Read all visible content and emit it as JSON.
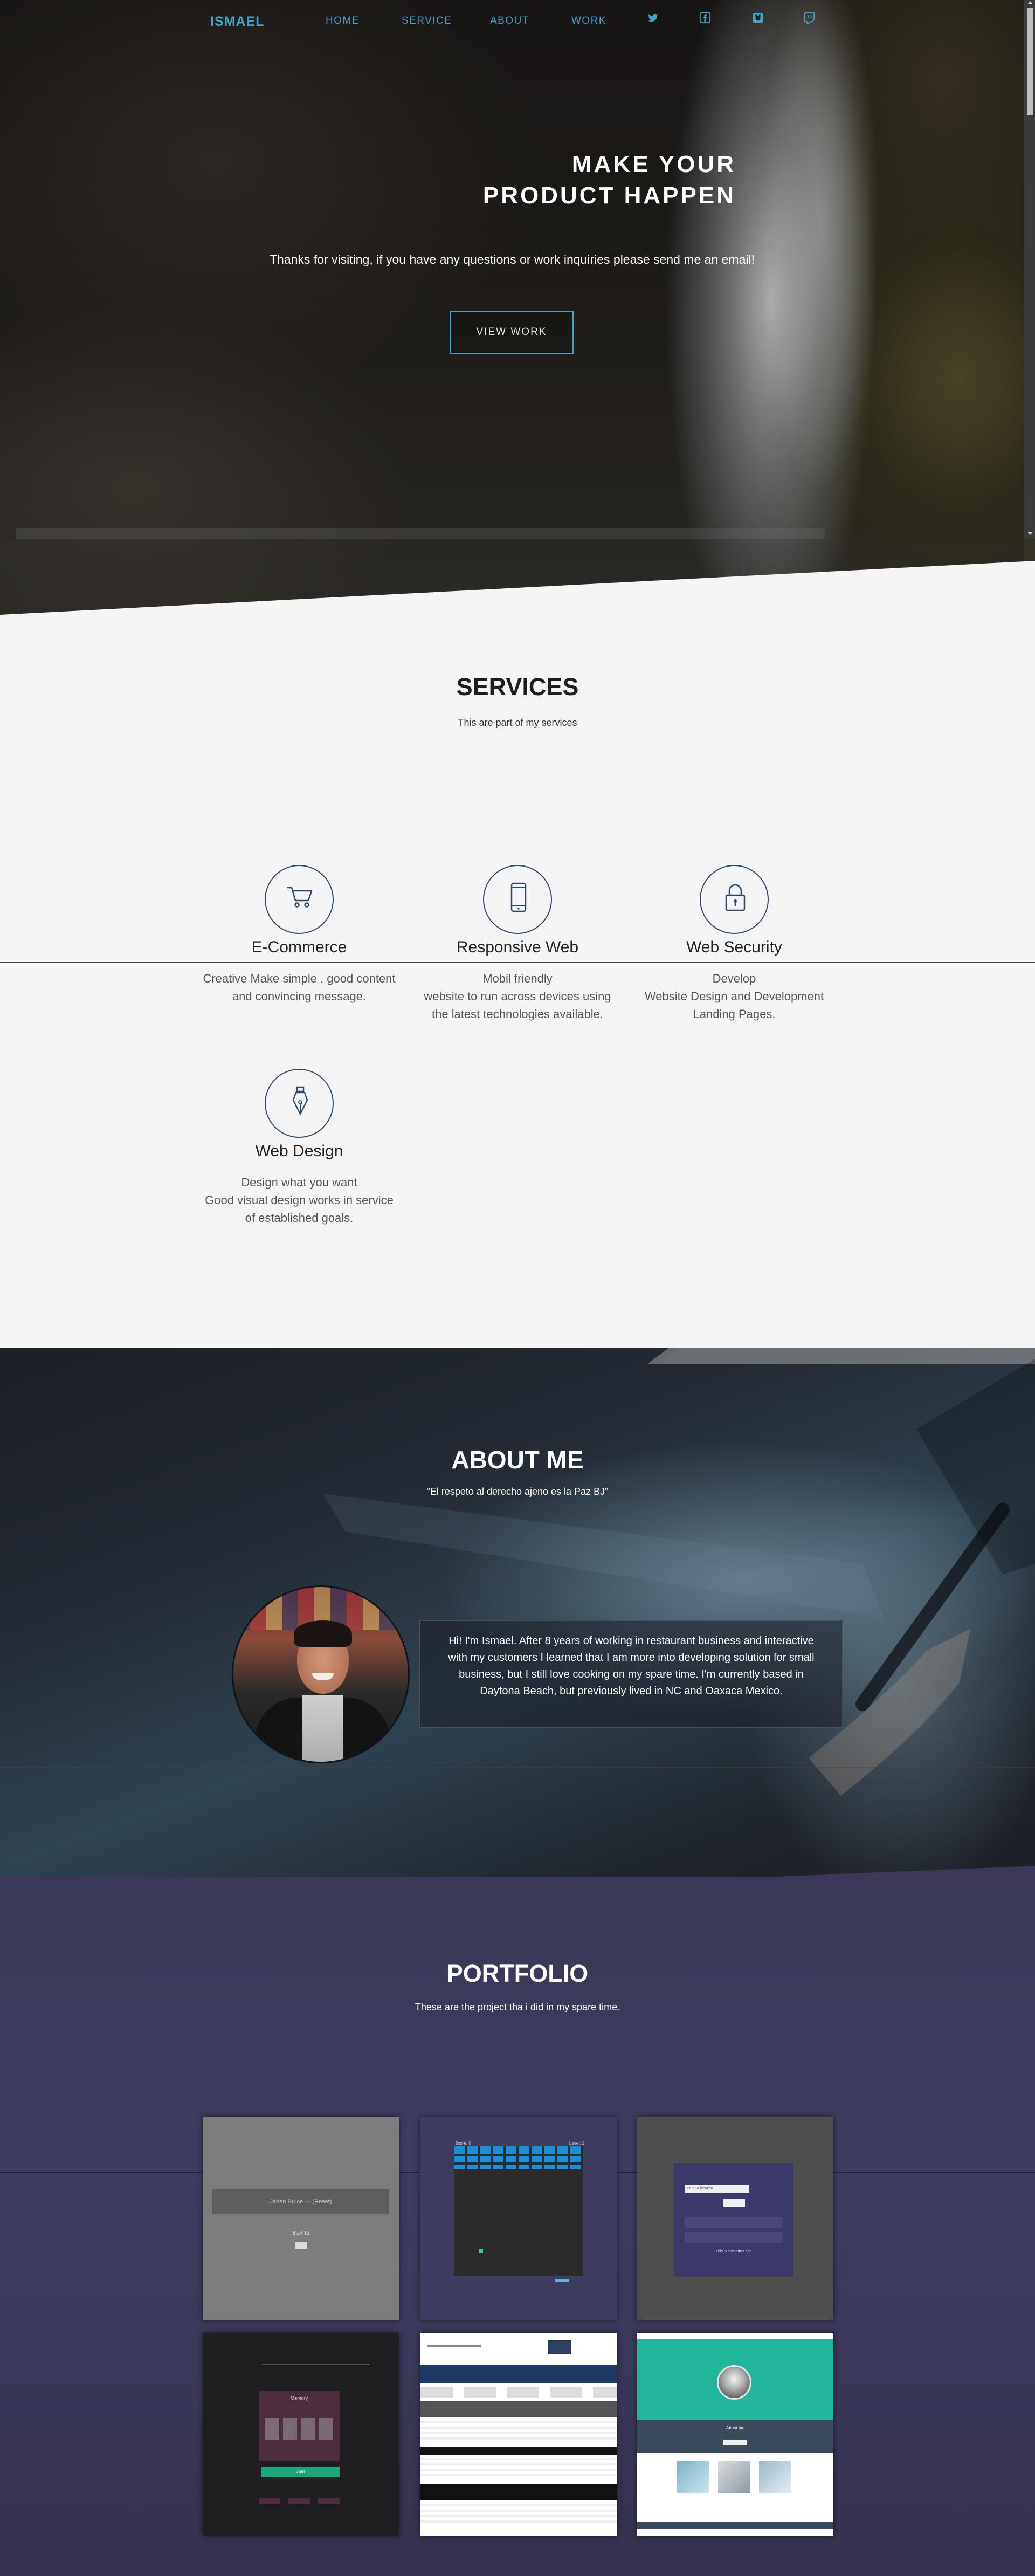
{
  "nav": {
    "brand": "ISMAEL",
    "links": [
      "HOME",
      "SERVICE",
      "ABOUT",
      "WORK"
    ],
    "icons": [
      "twitter-icon",
      "facebook-icon",
      "github-icon",
      "twitch-icon"
    ]
  },
  "hero": {
    "title_line1": "MAKE YOUR",
    "title_line2": "PRODUCT HAPPEN",
    "text": "Thanks for visiting, if you have any questions or work inquiries please send me an email!",
    "button": "VIEW WORK"
  },
  "services": {
    "title": "SERVICES",
    "subtitle": "This are part of my services",
    "items": [
      {
        "icon": "cart-icon",
        "title": "E-Commerce",
        "desc": [
          "Creative Make simple , good content",
          "and convincing message."
        ]
      },
      {
        "icon": "mobile-icon",
        "title": "Responsive Web",
        "desc": [
          "Mobil friendly",
          "website to run across devices using",
          "the latest technologies available."
        ]
      },
      {
        "icon": "lock-icon",
        "title": "Web Security",
        "desc": [
          "Develop",
          "Website Design and Development",
          "Landing Pages."
        ]
      },
      {
        "icon": "pen-icon",
        "title": "Web Design",
        "desc": [
          "Design what you want",
          "Good visual design works in service",
          "of established goals."
        ]
      }
    ]
  },
  "about": {
    "title": "ABOUT ME",
    "quote": "\"El respeto al derecho ajeno es la Paz BJ\"",
    "bio": "Hi! I'm Ismael. After 8 years of working in restaurant business and interactive with my customers I learned that I am more into developing solution for small business, but I still love cooking on my spare time. I'm currently based in Daytona Beach, but previously lived in NC and Oaxaca Mexico."
  },
  "portfolio": {
    "title": "PORTFOLIO",
    "subtitle": "These are the project tha i did in my spare time.",
    "projects": [
      {
        "screen_label": "Jaden Bruce — (Reset)",
        "screen_sub": "Start Yo"
      },
      {
        "screen_label": "Score: 0",
        "screen_sub": "Level: 1"
      },
      {
        "screen_label": "Enter a location",
        "screen_sub": "This is a weather app"
      },
      {
        "screen_label": "Memory",
        "screen_sub": "Start"
      },
      {
        "screen_label": "",
        "screen_sub": ""
      },
      {
        "screen_label": "About me",
        "screen_sub": ""
      }
    ]
  },
  "colors": {
    "accent": "#3fa6c6",
    "portfolio_bg": "#3a3856",
    "about_bg": "#1c1f26",
    "services_bg": "#f5f5f5"
  }
}
